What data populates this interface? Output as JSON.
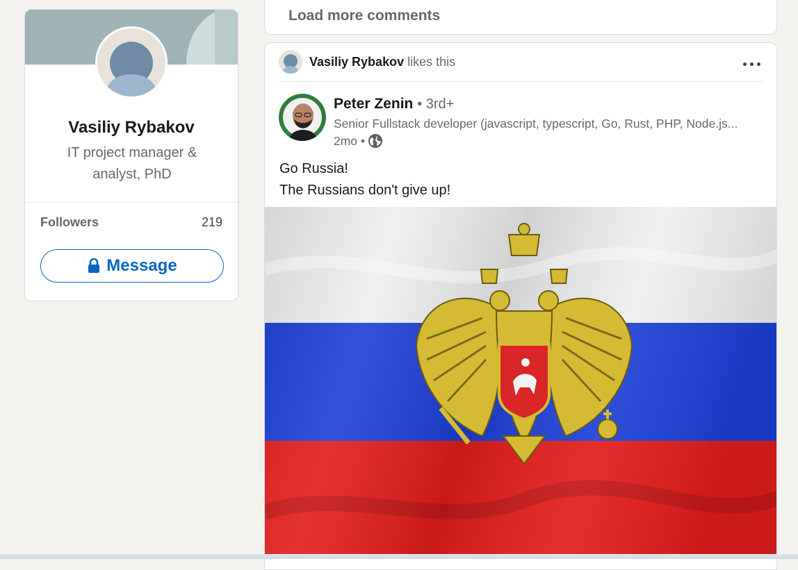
{
  "profile": {
    "name": "Vasiliy Rybakov",
    "headline": "IT project manager & analyst, PhD",
    "followers_label": "Followers",
    "followers_count": "219",
    "message_label": "Message"
  },
  "comments": {
    "load_more_label": "Load more comments"
  },
  "post": {
    "social_context": {
      "actor": "Vasiliy Rybakov",
      "action": "likes this"
    },
    "author": {
      "name": "Peter Zenin",
      "degree": "• 3rd+",
      "headline": "Senior Fullstack developer (javascript, typescript, Go, Rust, PHP, Node.js...",
      "time": "2mo •",
      "visibility_icon": "globe-icon"
    },
    "text_lines": [
      "Go Russia!",
      "The Russians don't give up!"
    ],
    "image_description": "russian-flag-with-double-headed-eagle-coat-of-arms"
  },
  "colors": {
    "page_background": "#f3f2ef",
    "accent": "#0a66c2",
    "flag_white": "#f0f0f0",
    "flag_blue": "#1a3fd8",
    "flag_red": "#e41d1d",
    "eagle_gold": "#d9c23a"
  }
}
